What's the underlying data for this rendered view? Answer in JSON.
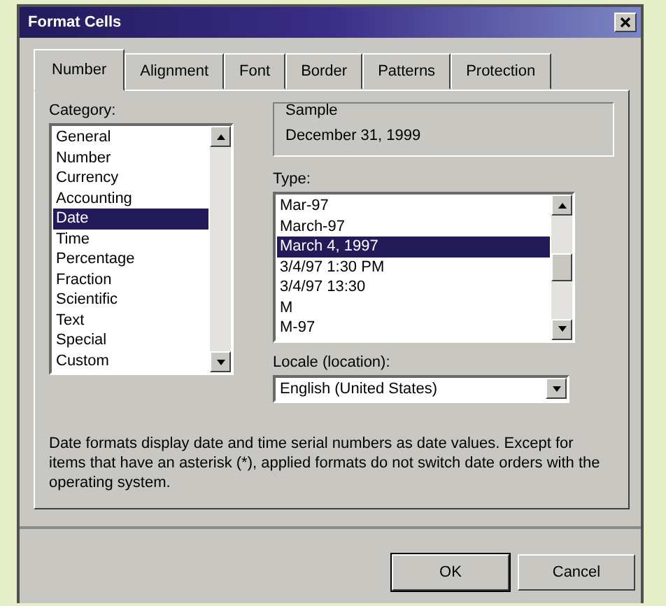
{
  "window": {
    "title": "Format Cells"
  },
  "tabs": [
    {
      "label": "Number",
      "selected": true
    },
    {
      "label": "Alignment",
      "selected": false
    },
    {
      "label": "Font",
      "selected": false
    },
    {
      "label": "Border",
      "selected": false
    },
    {
      "label": "Patterns",
      "selected": false
    },
    {
      "label": "Protection",
      "selected": false
    }
  ],
  "category": {
    "label": "Category:",
    "items": [
      {
        "label": "General",
        "selected": false
      },
      {
        "label": "Number",
        "selected": false
      },
      {
        "label": "Currency",
        "selected": false
      },
      {
        "label": "Accounting",
        "selected": false
      },
      {
        "label": "Date",
        "selected": true
      },
      {
        "label": "Time",
        "selected": false
      },
      {
        "label": "Percentage",
        "selected": false
      },
      {
        "label": "Fraction",
        "selected": false
      },
      {
        "label": "Scientific",
        "selected": false
      },
      {
        "label": "Text",
        "selected": false
      },
      {
        "label": "Special",
        "selected": false
      },
      {
        "label": "Custom",
        "selected": false
      }
    ]
  },
  "sample": {
    "label": "Sample",
    "value": "December 31, 1999"
  },
  "type": {
    "label": "Type:",
    "items": [
      {
        "label": "Mar-97",
        "selected": false
      },
      {
        "label": "March-97",
        "selected": false
      },
      {
        "label": "March 4, 1997",
        "selected": true
      },
      {
        "label": "3/4/97 1:30 PM",
        "selected": false
      },
      {
        "label": "3/4/97 13:30",
        "selected": false
      },
      {
        "label": "M",
        "selected": false
      },
      {
        "label": "M-97",
        "selected": false
      }
    ]
  },
  "locale": {
    "label": "Locale (location):",
    "value": "English (United States)"
  },
  "description": "Date formats display date and time serial numbers as date values. Except for items that have an asterisk (*), applied formats do not switch date orders with the operating system.",
  "buttons": [
    "OK",
    "Cancel"
  ]
}
